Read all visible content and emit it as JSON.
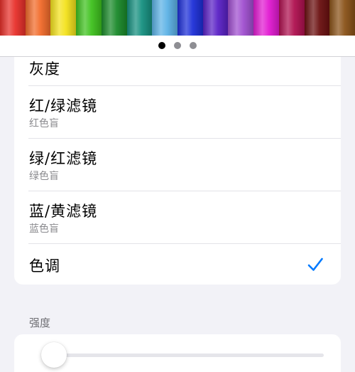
{
  "header": {
    "pencil_colors": [
      "#e8302a",
      "#f26b2a",
      "#f4e21c",
      "#3fc21e",
      "#1a8a2a",
      "#169080",
      "#5cb2e6",
      "#1d2fd8",
      "#5a21c6",
      "#a04fd0",
      "#e21ad2",
      "#b01150",
      "#6b1010",
      "#8a5218"
    ],
    "page_indicator": {
      "total": 3,
      "active": 0
    }
  },
  "filters": {
    "items": [
      {
        "label": "灰度",
        "sublabel": "",
        "selected": false
      },
      {
        "label": "红/绿滤镜",
        "sublabel": "红色盲",
        "selected": false
      },
      {
        "label": "绿/红滤镜",
        "sublabel": "绿色盲",
        "selected": false
      },
      {
        "label": "蓝/黄滤镜",
        "sublabel": "蓝色盲",
        "selected": false
      },
      {
        "label": "色调",
        "sublabel": "",
        "selected": true
      }
    ],
    "checkmark_icon": "checkmark-icon",
    "accent_color": "#007aff"
  },
  "intensity": {
    "section_label": "强度",
    "value": 0.04
  }
}
